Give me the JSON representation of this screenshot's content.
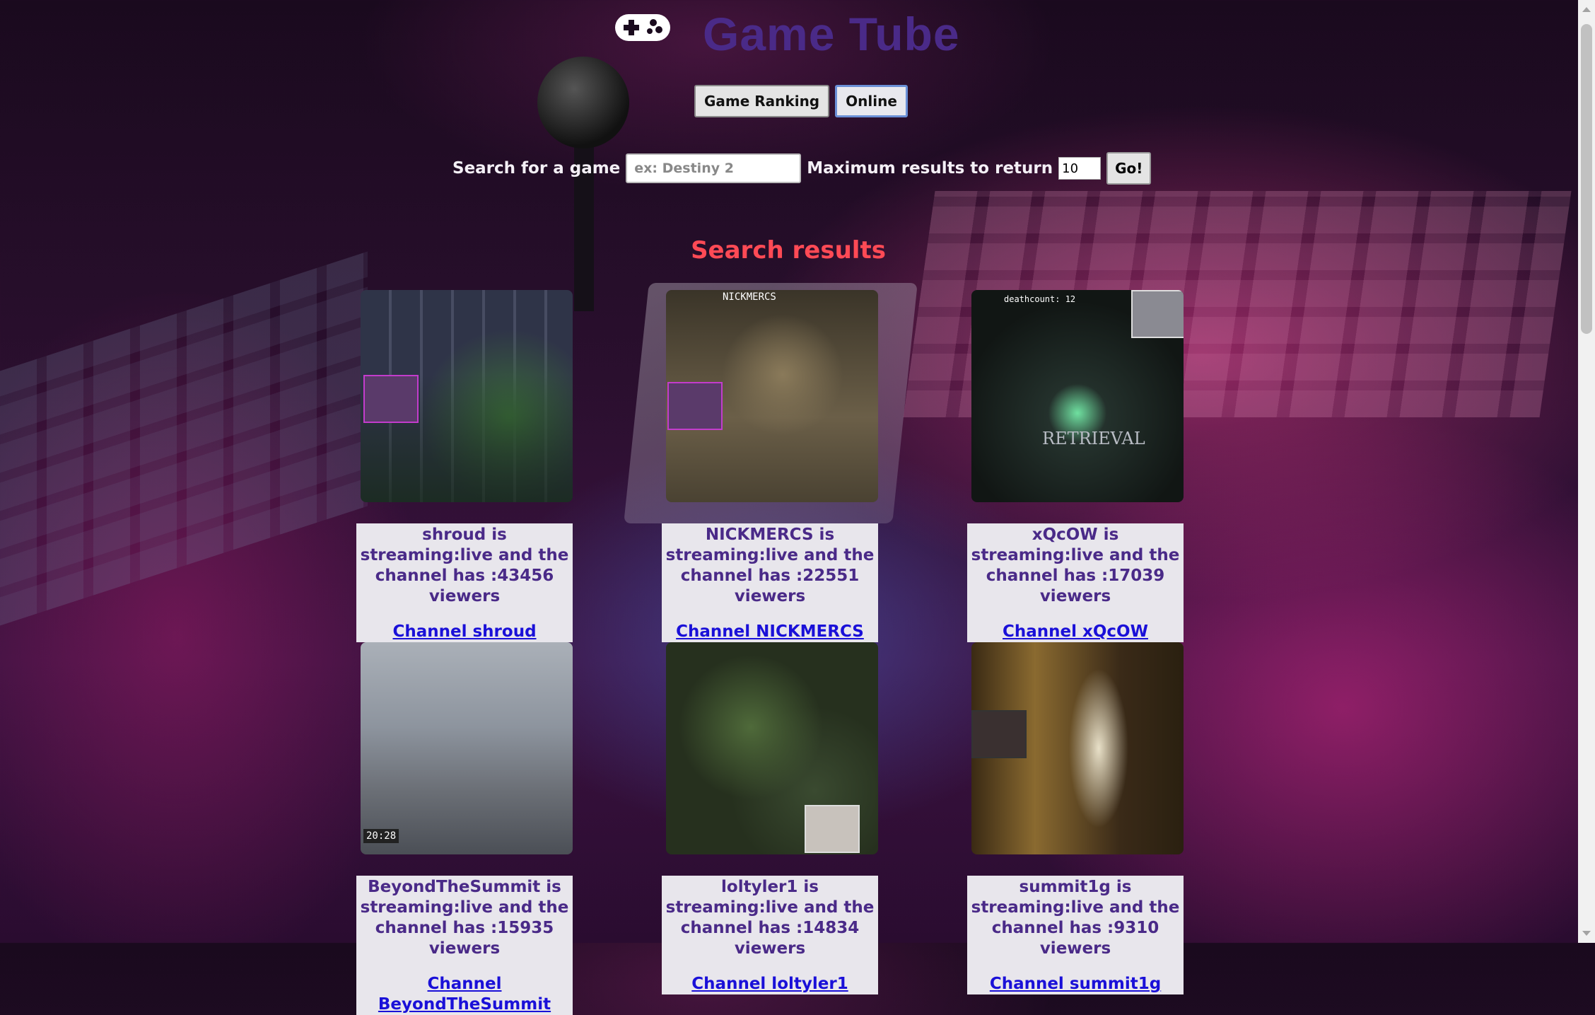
{
  "app": {
    "title": "Game Tube",
    "logo_icon": "gamepad-icon"
  },
  "nav": {
    "ranking_label": "Game Ranking",
    "online_label": "Online"
  },
  "search": {
    "game_label": "Search for a game",
    "game_placeholder": "ex: Destiny 2",
    "max_label": "Maximum results to return",
    "max_value": "10",
    "go_label": "Go!"
  },
  "results": {
    "title": "Search results",
    "items": [
      {
        "text": "shroud is streaming:live and the channel has :43456 viewers",
        "link": "Channel shroud"
      },
      {
        "text": "NICKMERCS is streaming:live and the channel has :22551 viewers",
        "link": "Channel NICKMERCS"
      },
      {
        "text": "xQcOW is streaming:live and the channel has :17039 viewers",
        "link": "Channel xQcOW"
      },
      {
        "text": "BeyondTheSummit is streaming:live and the channel has :15935 viewers",
        "link": "Channel BeyondTheSummit"
      },
      {
        "text": "loltyler1 is streaming:live and the channel has :14834 viewers",
        "link": "Channel loltyler1"
      },
      {
        "text": "summit1g is streaming:live and the channel has :9310 viewers",
        "link": "Channel summit1g"
      }
    ],
    "thumb_overlays": {
      "t3": "RETRIEVAL",
      "t3_hud": "deathcount: 12",
      "t4": "20:28",
      "t2_tag": "NICKMERCS"
    }
  },
  "colors": {
    "title": "#4a2a88",
    "results_title": "#ff4a55",
    "link": "#1a10d8"
  }
}
